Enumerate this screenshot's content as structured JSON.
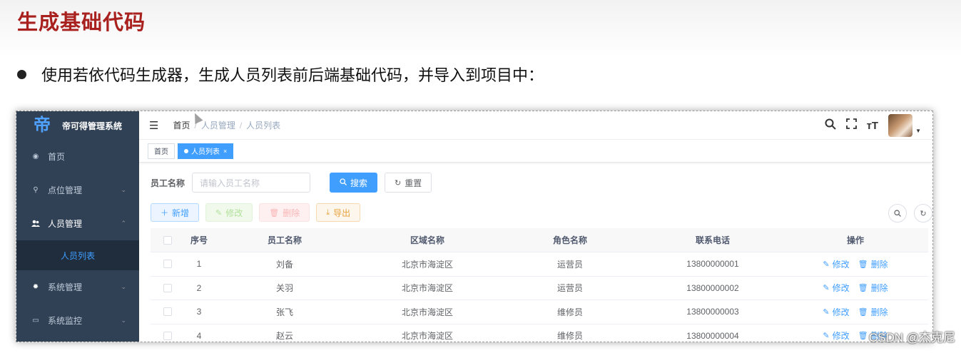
{
  "slide": {
    "title": "生成基础代码",
    "bullet": "使用若依代码生成器，生成人员列表前后端基础代码，并导入到项目中：",
    "watermark": "CSDN @杰克尼"
  },
  "app": {
    "logo_glyph": "帝",
    "name": "帝可得管理系统",
    "accent_color": "#409eff",
    "sidebar_bg": "#304156"
  },
  "sidebar": {
    "items": [
      {
        "label": "首页",
        "icon": "dashboard-icon",
        "glyph": "◉"
      },
      {
        "label": "点位管理",
        "icon": "location-icon",
        "glyph": "⚲",
        "chevron": "⌄"
      },
      {
        "label": "人员管理",
        "icon": "people-icon",
        "glyph": "👥",
        "chevron": "⌃"
      },
      {
        "label": "系统管理",
        "icon": "gear-icon",
        "glyph": "✹",
        "chevron": "⌄"
      },
      {
        "label": "系统监控",
        "icon": "monitor-icon",
        "glyph": "▭",
        "chevron": "⌄"
      }
    ],
    "sub_item": "人员列表"
  },
  "navbar": {
    "breadcrumb": [
      "首页",
      "人员管理",
      "人员列表"
    ],
    "separator": "/"
  },
  "tags": {
    "home": "首页",
    "active": "人员列表",
    "close": "×"
  },
  "search": {
    "label": "员工名称",
    "placeholder": "请输入员工名称",
    "search_btn": "搜索",
    "reset_btn": "重置"
  },
  "toolbar": {
    "add": "新增",
    "edit": "修改",
    "delete": "删除",
    "export": "导出"
  },
  "table": {
    "headers": [
      "序号",
      "员工名称",
      "区域名称",
      "角色名称",
      "联系电话",
      "操作"
    ],
    "rows": [
      {
        "idx": "1",
        "name": "刘备",
        "area": "北京市海淀区",
        "role": "运营员",
        "phone": "13800000001"
      },
      {
        "idx": "2",
        "name": "关羽",
        "area": "北京市海淀区",
        "role": "运营员",
        "phone": "13800000002"
      },
      {
        "idx": "3",
        "name": "张飞",
        "area": "北京市海淀区",
        "role": "维修员",
        "phone": "13800000003"
      },
      {
        "idx": "4",
        "name": "赵云",
        "area": "北京市海淀区",
        "role": "维修员",
        "phone": "13800000004"
      }
    ],
    "op_edit": "修改",
    "op_delete": "删除"
  }
}
